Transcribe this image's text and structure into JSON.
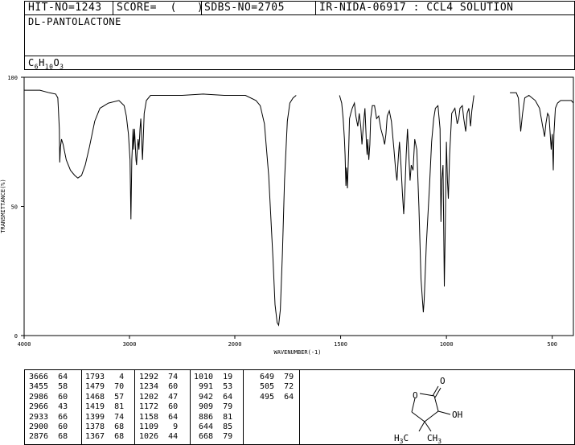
{
  "header": {
    "hit_no": "HIT-NO=1243",
    "score": "SCORE=  (   )",
    "sdbs_no": "SDBS-NO=2705",
    "ir_info": "IR-NIDA-06917 : CCL4 SOLUTION",
    "compound_name": "DL-PANTOLACTONE",
    "formula": {
      "c": "C",
      "c_n": "6",
      "h": "H",
      "h_n": "10",
      "o": "O",
      "o_n": "3"
    }
  },
  "chart_data": {
    "type": "line",
    "xlabel": "WAVENUMBER(-1)",
    "ylabel": "TRANSMITTANCE(%)",
    "xlim": [
      4000,
      400
    ],
    "ylim": [
      0,
      100
    ],
    "x_ticks": [
      4000,
      3000,
      2000,
      1500,
      1000,
      500
    ],
    "x_tick_labels": [
      "4000",
      "3000",
      "2000",
      "1500",
      "1000",
      "500"
    ],
    "y_ticks": [
      0,
      50,
      100
    ],
    "y_tick_labels": [
      "0",
      "50",
      "100"
    ],
    "series": [
      {
        "segments": [
          [
            [
              4000,
              95
            ],
            [
              3850,
              95
            ],
            [
              3760,
              94
            ],
            [
              3700,
              93.5
            ],
            [
              3680,
              92
            ],
            [
              3666,
              80
            ],
            [
              3662,
              67
            ],
            [
              3655,
              73
            ],
            [
              3645,
              76
            ],
            [
              3630,
              74
            ],
            [
              3600,
              68
            ],
            [
              3560,
              64
            ],
            [
              3520,
              62
            ],
            [
              3490,
              61
            ],
            [
              3455,
              62
            ],
            [
              3420,
              66
            ],
            [
              3380,
              73
            ],
            [
              3330,
              83
            ],
            [
              3280,
              88
            ],
            [
              3200,
              90
            ],
            [
              3100,
              91
            ],
            [
              3050,
              89
            ],
            [
              3030,
              85
            ],
            [
              3010,
              78
            ],
            [
              2995,
              68
            ],
            [
              2986,
              45
            ],
            [
              2978,
              68
            ],
            [
              2972,
              74
            ],
            [
              2966,
              80
            ],
            [
              2960,
              72
            ],
            [
              2952,
              80
            ],
            [
              2945,
              74
            ],
            [
              2938,
              68
            ],
            [
              2933,
              66
            ],
            [
              2928,
              70
            ],
            [
              2918,
              76
            ],
            [
              2910,
              72
            ],
            [
              2900,
              80
            ],
            [
              2892,
              84
            ],
            [
              2885,
              76
            ],
            [
              2876,
              68
            ],
            [
              2870,
              75
            ],
            [
              2860,
              86
            ],
            [
              2840,
              91
            ],
            [
              2800,
              93
            ],
            [
              2700,
              93
            ],
            [
              2500,
              93
            ],
            [
              2300,
              93.5
            ],
            [
              2100,
              93
            ],
            [
              1950,
              93
            ],
            [
              1900,
              91
            ],
            [
              1880,
              89
            ],
            [
              1860,
              82
            ],
            [
              1840,
              62
            ],
            [
              1820,
              30
            ],
            [
              1810,
              12
            ],
            [
              1800,
              5
            ],
            [
              1793,
              4
            ],
            [
              1785,
              10
            ],
            [
              1775,
              32
            ],
            [
              1765,
              60
            ],
            [
              1752,
              83
            ],
            [
              1740,
              90
            ],
            [
              1725,
              92
            ],
            [
              1710,
              93
            ]
          ],
          [
            [
              1505,
              93
            ],
            [
              1495,
              90
            ],
            [
              1488,
              84
            ],
            [
              1482,
              76
            ],
            [
              1479,
              70
            ],
            [
              1475,
              58
            ],
            [
              1472,
              65
            ],
            [
              1468,
              57
            ],
            [
              1462,
              72
            ],
            [
              1458,
              84
            ],
            [
              1452,
              86
            ],
            [
              1445,
              88
            ],
            [
              1435,
              90
            ],
            [
              1428,
              85
            ],
            [
              1419,
              81
            ],
            [
              1412,
              86
            ],
            [
              1405,
              81
            ],
            [
              1399,
              74
            ],
            [
              1392,
              82
            ],
            [
              1385,
              88
            ],
            [
              1378,
              74
            ],
            [
              1375,
              70
            ],
            [
              1372,
              76
            ],
            [
              1367,
              68
            ],
            [
              1362,
              74
            ],
            [
              1358,
              84
            ],
            [
              1350,
              89
            ],
            [
              1340,
              89
            ],
            [
              1330,
              84
            ],
            [
              1320,
              85
            ],
            [
              1310,
              80
            ],
            [
              1300,
              77
            ],
            [
              1292,
              74
            ],
            [
              1286,
              78
            ],
            [
              1280,
              85
            ],
            [
              1270,
              87
            ],
            [
              1260,
              83
            ],
            [
              1248,
              72
            ],
            [
              1240,
              64
            ],
            [
              1234,
              60
            ],
            [
              1228,
              68
            ],
            [
              1222,
              75
            ],
            [
              1215,
              66
            ],
            [
              1208,
              55
            ],
            [
              1202,
              47
            ],
            [
              1196,
              57
            ],
            [
              1190,
              70
            ],
            [
              1184,
              80
            ],
            [
              1178,
              70
            ],
            [
              1172,
              60
            ],
            [
              1166,
              66
            ],
            [
              1158,
              64
            ],
            [
              1150,
              76
            ],
            [
              1140,
              72
            ],
            [
              1130,
              50
            ],
            [
              1120,
              22
            ],
            [
              1112,
              12
            ],
            [
              1109,
              9
            ],
            [
              1105,
              14
            ],
            [
              1095,
              35
            ],
            [
              1080,
              58
            ],
            [
              1070,
              75
            ],
            [
              1060,
              84
            ],
            [
              1052,
              88
            ],
            [
              1040,
              89
            ],
            [
              1030,
              80
            ],
            [
              1026,
              44
            ],
            [
              1022,
              60
            ],
            [
              1016,
              66
            ],
            [
              1010,
              19
            ],
            [
              1006,
              38
            ],
            [
              1000,
              75
            ],
            [
              995,
              60
            ],
            [
              991,
              53
            ],
            [
              985,
              70
            ],
            [
              975,
              86
            ],
            [
              960,
              88
            ],
            [
              949,
              82
            ],
            [
              942,
              84
            ],
            [
              936,
              88
            ],
            [
              925,
              89
            ],
            [
              918,
              84
            ],
            [
              909,
              79
            ],
            [
              902,
              86
            ],
            [
              894,
              88
            ],
            [
              886,
              81
            ],
            [
              880,
              87
            ],
            [
              870,
              93
            ]
          ],
          [
            [
              700,
              94
            ],
            [
              670,
              94
            ],
            [
              660,
              92
            ],
            [
              655,
              86
            ],
            [
              649,
              79
            ],
            [
              640,
              86
            ],
            [
              630,
              92
            ],
            [
              610,
              93
            ],
            [
              580,
              91
            ],
            [
              560,
              88
            ],
            [
              545,
              81
            ],
            [
              536,
              77
            ],
            [
              530,
              82
            ],
            [
              522,
              86
            ],
            [
              515,
              85
            ],
            [
              505,
              72
            ],
            [
              500,
              78
            ],
            [
              495,
              64
            ],
            [
              492,
              78
            ],
            [
              485,
              88
            ],
            [
              475,
              90
            ],
            [
              460,
              91
            ],
            [
              440,
              91
            ],
            [
              425,
              91
            ],
            [
              410,
              91
            ],
            [
              400,
              90
            ]
          ]
        ]
      }
    ],
    "peaks": [
      [
        3666,
        64
      ],
      [
        3455,
        58
      ],
      [
        2986,
        60
      ],
      [
        2966,
        43
      ],
      [
        2933,
        66
      ],
      [
        2900,
        60
      ],
      [
        2876,
        68
      ],
      [
        1793,
        4
      ],
      [
        1479,
        70
      ],
      [
        1468,
        57
      ],
      [
        1419,
        81
      ],
      [
        1399,
        74
      ],
      [
        1378,
        68
      ],
      [
        1367,
        68
      ],
      [
        1292,
        74
      ],
      [
        1234,
        60
      ],
      [
        1202,
        47
      ],
      [
        1172,
        60
      ],
      [
        1158,
        64
      ],
      [
        1109,
        9
      ],
      [
        1026,
        44
      ],
      [
        1010,
        19
      ],
      [
        991,
        53
      ],
      [
        942,
        64
      ],
      [
        909,
        79
      ],
      [
        886,
        81
      ],
      [
        644,
        85
      ],
      [
        668,
        79
      ],
      [
        649,
        79
      ],
      [
        505,
        72
      ],
      [
        495,
        64
      ]
    ]
  },
  "peak_columns": [
    [
      "3666  64",
      "3455  58",
      "2986  60",
      "2966  43",
      "2933  66",
      "2900  60",
      "2876  68"
    ],
    [
      "1793   4",
      "1479  70",
      "1468  57",
      "1419  81",
      "1399  74",
      "1378  68",
      "1367  68"
    ],
    [
      "1292  74",
      "1234  60",
      "1202  47",
      "1172  60",
      "1158  64",
      "1109   9",
      "1026  44"
    ],
    [
      "1010  19",
      " 991  53",
      " 942  64",
      " 909  79",
      " 886  81",
      " 644  85",
      " 668  79"
    ],
    [
      " 649  79",
      " 505  72",
      " 495  64"
    ]
  ],
  "structure": {
    "o_carbonyl": "O",
    "o_ring": "O",
    "oh": "OH",
    "ch3_left_prefix": "H",
    "ch3_left_sub": "3",
    "ch3_left_suffix": "C",
    "ch3_right_prefix": "CH",
    "ch3_right_sub": "3"
  }
}
